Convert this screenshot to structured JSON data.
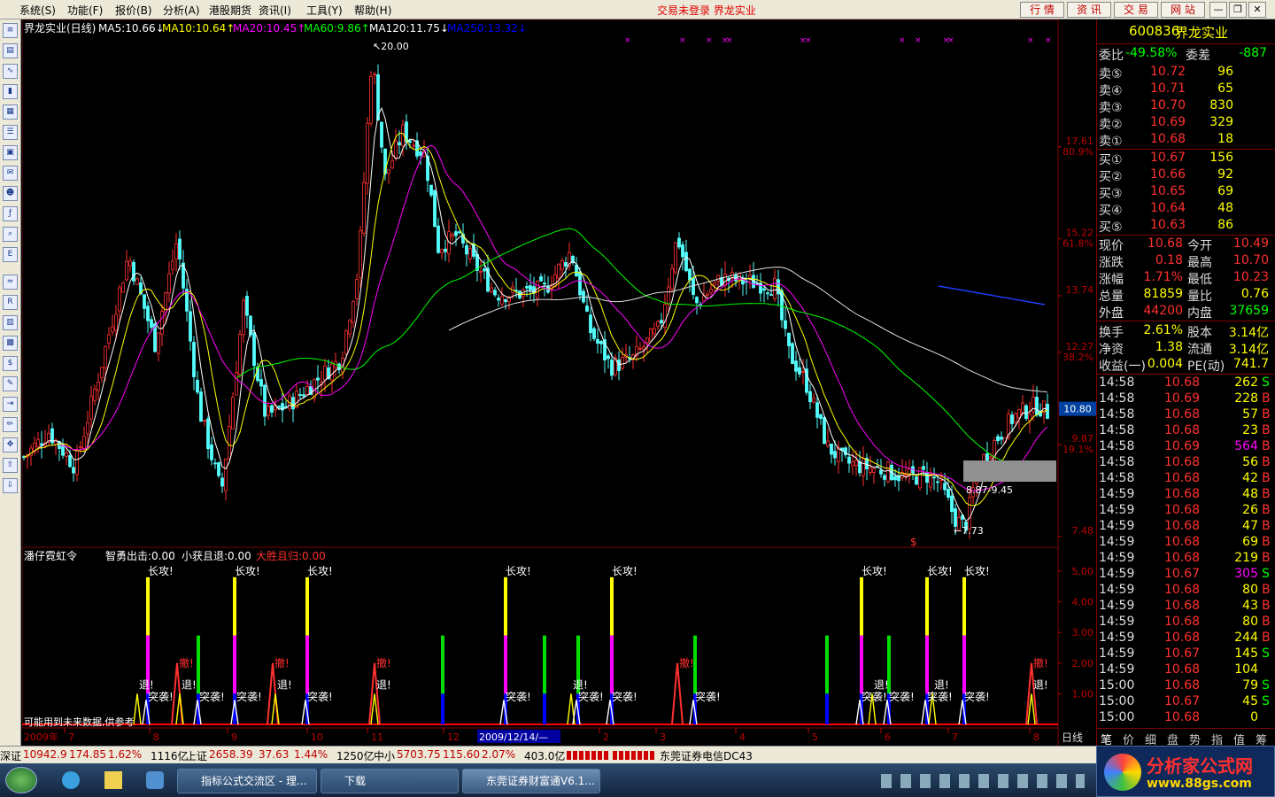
{
  "menu": {
    "items": [
      "系统(S)",
      "功能(F)",
      "报价(B)",
      "分析(A)",
      "港股期货",
      "资讯(I)",
      "工具(Y)",
      "帮助(H)"
    ],
    "status": "交易未登录",
    "stock_name_title": "界龙实业",
    "tabs": [
      "行 情",
      "资 讯",
      "交 易",
      "网 站"
    ]
  },
  "chart": {
    "title": "界龙实业(日线)",
    "ma": [
      {
        "label": "MA5:10.66",
        "arrow": "↓",
        "color": "#ffffff"
      },
      {
        "label": "MA10:10.64",
        "arrow": "↑",
        "color": "#ffff00"
      },
      {
        "label": "MA20:10.45",
        "arrow": "↑",
        "color": "#ff00ff"
      },
      {
        "label": "MA60:9.86",
        "arrow": "↑",
        "color": "#00ff00"
      },
      {
        "label": "MA120:11.75",
        "arrow": "↓",
        "color": "#ffffff"
      },
      {
        "label": "MA250:13.32",
        "arrow": "↓",
        "color": "#0000ff"
      }
    ],
    "price_axis": [
      {
        "v": "17.61",
        "p": "80.9%"
      },
      {
        "v": "15.22",
        "p": "61.8%"
      },
      {
        "v": "13.74",
        "p": ""
      },
      {
        "v": "12.27",
        "p": "38.2%"
      },
      {
        "v": "9.87",
        "p": "19.1%"
      },
      {
        "v": "7.48",
        "p": ""
      }
    ],
    "current_price": "10.80",
    "high_label": "20.00",
    "low_label": "7.73",
    "range_label": "8.87-9.45",
    "dollar": "$"
  },
  "indicator": {
    "name": "潘仔霓虹令",
    "v1": "智勇出击:0.00",
    "v2": "小获且退:0.00",
    "v3": "大胜且归:0.00",
    "axis": [
      "5.00",
      "4.00",
      "3.00",
      "2.00",
      "1.00"
    ],
    "note": "可能用到未来数据,供参考",
    "sig_long": "长攻!",
    "sig_retreat": "退!",
    "sig_raid": "突袭!",
    "sig_withdraw": "撤!"
  },
  "xaxis": {
    "labels": [
      "2009年",
      "7",
      "8",
      "9",
      "10",
      "11",
      "12",
      "2009/12/14/—",
      "2",
      "3",
      "4",
      "5",
      "6",
      "7",
      "8"
    ],
    "period": "日线"
  },
  "quote": {
    "code": "600836",
    "name": "界龙实业",
    "weibi_label": "委比",
    "weibi": "-49.58%",
    "weicha_label": "委差",
    "weicha": "-887",
    "sell": [
      {
        "l": "卖⑤",
        "p": "10.72",
        "v": "96"
      },
      {
        "l": "卖④",
        "p": "10.71",
        "v": "65"
      },
      {
        "l": "卖③",
        "p": "10.70",
        "v": "830"
      },
      {
        "l": "卖②",
        "p": "10.69",
        "v": "329"
      },
      {
        "l": "卖①",
        "p": "10.68",
        "v": "18"
      }
    ],
    "buy": [
      {
        "l": "买①",
        "p": "10.67",
        "v": "156"
      },
      {
        "l": "买②",
        "p": "10.66",
        "v": "92"
      },
      {
        "l": "买③",
        "p": "10.65",
        "v": "69"
      },
      {
        "l": "买④",
        "p": "10.64",
        "v": "48"
      },
      {
        "l": "买⑤",
        "p": "10.63",
        "v": "86"
      }
    ],
    "stats": [
      {
        "a": "现价",
        "av": "10.68",
        "b": "今开",
        "bv": "10.49"
      },
      {
        "a": "涨跌",
        "av": "0.18",
        "b": "最高",
        "bv": "10.70"
      },
      {
        "a": "涨幅",
        "av": "1.71%",
        "b": "最低",
        "bv": "10.23"
      },
      {
        "a": "总量",
        "av": "81859",
        "b": "量比",
        "bv": "0.76"
      },
      {
        "a": "外盘",
        "av": "44200",
        "b": "内盘",
        "bv": "37659"
      }
    ],
    "stats2": [
      {
        "a": "换手",
        "av": "2.61%",
        "b": "股本",
        "bv": "3.14亿"
      },
      {
        "a": "净资",
        "av": "1.38",
        "b": "流通",
        "bv": "3.14亿"
      },
      {
        "a": "收益(一)",
        "av": "0.004",
        "b": "PE(动)",
        "bv": "741.7"
      }
    ],
    "ticks": [
      [
        "14:58",
        "10.68",
        "262",
        "S"
      ],
      [
        "14:58",
        "10.69",
        "228",
        "B"
      ],
      [
        "14:58",
        "10.68",
        "57",
        "B"
      ],
      [
        "14:58",
        "10.68",
        "23",
        "B"
      ],
      [
        "14:58",
        "10.69",
        "564",
        "B"
      ],
      [
        "14:58",
        "10.68",
        "56",
        "B"
      ],
      [
        "14:58",
        "10.68",
        "42",
        "B"
      ],
      [
        "14:59",
        "10.68",
        "48",
        "B"
      ],
      [
        "14:59",
        "10.68",
        "26",
        "B"
      ],
      [
        "14:59",
        "10.68",
        "47",
        "B"
      ],
      [
        "14:59",
        "10.68",
        "69",
        "B"
      ],
      [
        "14:59",
        "10.68",
        "219",
        "B"
      ],
      [
        "14:59",
        "10.67",
        "305",
        "S"
      ],
      [
        "14:59",
        "10.68",
        "80",
        "B"
      ],
      [
        "14:59",
        "10.68",
        "43",
        "B"
      ],
      [
        "14:59",
        "10.68",
        "80",
        "B"
      ],
      [
        "14:59",
        "10.68",
        "244",
        "B"
      ],
      [
        "14:59",
        "10.67",
        "145",
        "S"
      ],
      [
        "14:59",
        "10.68",
        "104",
        ""
      ],
      [
        "15:00",
        "10.68",
        "79",
        "S"
      ],
      [
        "15:00",
        "10.67",
        "45",
        "S"
      ],
      [
        "15:00",
        "10.68",
        "0",
        ""
      ]
    ],
    "tabs": [
      "笔",
      "价",
      "细",
      "盘",
      "势",
      "指",
      "值",
      "筹"
    ]
  },
  "bottom": {
    "sz_label": "深证",
    "sz": "10942.9",
    "sz_chg": "174.85",
    "sz_pct": "1.62%",
    "sz_amt": "1116亿",
    "sh_label": "上证",
    "sh": "2658.39",
    "sh_chg": "37.63",
    "sh_pct": "1.44%",
    "sh_amt": "1250亿",
    "zx_label": "中小",
    "zx": "5703.75",
    "zx_chg": "115.60",
    "zx_pct": "2.07%",
    "zx_amt": "403.0亿",
    "broker": "东莞证券电信DC43"
  },
  "taskbar": {
    "items": [
      "指标公式交流区 - 理...",
      "下载",
      "东莞证券财富通V6.1..."
    ]
  },
  "logo": {
    "title": "分析家公式网",
    "url": "www.88gs.com"
  }
}
